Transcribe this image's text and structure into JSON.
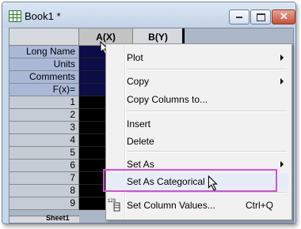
{
  "window": {
    "title": "Book1 *",
    "icon": "workbook-grid-icon"
  },
  "sheet": {
    "columns": [
      {
        "label": "A(X)",
        "selected": true
      },
      {
        "label": "B(Y)",
        "selected": false
      }
    ],
    "header_rows": [
      "Long Name",
      "Units",
      "Comments",
      "F(x)="
    ],
    "data_rows": [
      "1",
      "2",
      "3",
      "4",
      "5",
      "6",
      "7",
      "8",
      "9"
    ],
    "sheet_tab": "Sheet1"
  },
  "context_menu": {
    "items": [
      {
        "label": "Plot",
        "submenu": true
      },
      {
        "label": "Copy",
        "submenu": true
      },
      {
        "label": "Copy Columns to...",
        "submenu": false
      },
      {
        "label": "Insert",
        "submenu": false
      },
      {
        "label": "Delete",
        "submenu": false
      },
      {
        "label": "Set As",
        "submenu": true
      },
      {
        "label": "Set As Categorical",
        "submenu": false,
        "highlighted": true
      },
      {
        "label": "Set Column Values...",
        "shortcut": "Ctrl+Q",
        "icon": "set-column-values-icon"
      }
    ]
  },
  "colors": {
    "highlight_border": "#d54fd5",
    "selected_column_fill": "#000000",
    "metadata_fill": "#0c0c46"
  }
}
